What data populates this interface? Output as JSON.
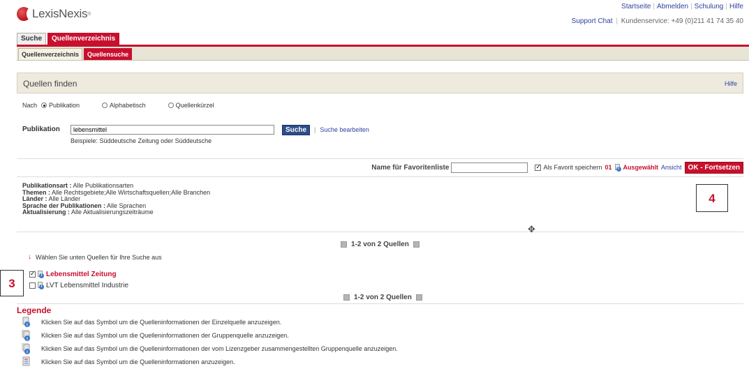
{
  "header": {
    "logo_text": "LexisNexis",
    "logo_reg": "®",
    "toplinks": [
      "Startseite",
      "Abmelden",
      "Schulung",
      "Hilfe"
    ],
    "support_chat": "Support Chat",
    "kundenservice": "Kundenservice: +49 (0)211 41 74 35 40"
  },
  "maintabs": [
    {
      "label": "Suche",
      "active": false
    },
    {
      "label": "Quellenverzeichnis",
      "active": true
    }
  ],
  "subtabs": [
    {
      "label": "Quellenverzeichnis",
      "active": false
    },
    {
      "label": "Quellensuche",
      "active": true
    }
  ],
  "panel": {
    "title": "Quellen finden",
    "help": "Hilfe"
  },
  "nach": {
    "label": "Nach",
    "options": [
      {
        "label": "Publikation",
        "checked": true
      },
      {
        "label": "Alphabetisch",
        "checked": false
      },
      {
        "label": "Quellenkürzel",
        "checked": false
      }
    ]
  },
  "publikation": {
    "label": "Publikation",
    "value": "lebensmittel",
    "search_button": "Suche",
    "edit_link": "Suche bearbeiten",
    "example": "Beispiele: Süddeutsche Zeitung oder Süddeutsche"
  },
  "favoriten": {
    "label": "Name für Favoritenliste",
    "value": "",
    "save_label": "Als Favorit speichern",
    "save_checked": true,
    "count": "01",
    "selected_label": "Ausgewählt",
    "view_link": "Ansicht",
    "ok_button": "OK - Fortsetzen"
  },
  "filters": [
    {
      "key": "Publikationsart :",
      "value": "Alle Publikationsarten"
    },
    {
      "key": "Themen :",
      "value": "Alle Rechtsgebiete;Alle Wirtschaftsquellen;Alle Branchen"
    },
    {
      "key": "Länder :",
      "value": "Alle Länder"
    },
    {
      "key": "Sprache der Publikationen :",
      "value": "Alle Sprachen"
    },
    {
      "key": "Aktualisierung :",
      "value": "Alle Aktualisierungszeiträume"
    }
  ],
  "callouts": {
    "c3": "3",
    "c4": "4"
  },
  "pager": {
    "text": "1-2 von 2 Quellen"
  },
  "hint": "Wählen Sie unten Quellen für Ihre Suche aus",
  "sources": [
    {
      "name": "Lebensmittel Zeitung",
      "checked": true
    },
    {
      "name": "LVT Lebensmittel Industrie",
      "checked": false
    }
  ],
  "legende": {
    "title": "Legende",
    "rows": [
      {
        "icon": "single-source-info-icon",
        "text": "Klicken Sie auf das Symbol um die Quelleninformationen der Einzelquelle anzuzeigen."
      },
      {
        "icon": "group-source-info-icon",
        "text": "Klicken Sie auf das Symbol um die Quelleninformationen der Gruppenquelle anzuzeigen."
      },
      {
        "icon": "licensor-group-source-info-icon",
        "text": "Klicken Sie auf das Symbol um die Quelleninformationen der vom Lizenzgeber zusammengestellten Gruppenquelle anzuzeigen."
      },
      {
        "icon": "source-info-icon",
        "text": "Klicken Sie auf das Symbol um die Quelleninformationen anzuzeigen."
      }
    ]
  },
  "colors": {
    "accent": "#c8102e",
    "link": "#2f3f9f",
    "panel_bg": "#eeeade",
    "search_button": "#2c4e8a"
  }
}
